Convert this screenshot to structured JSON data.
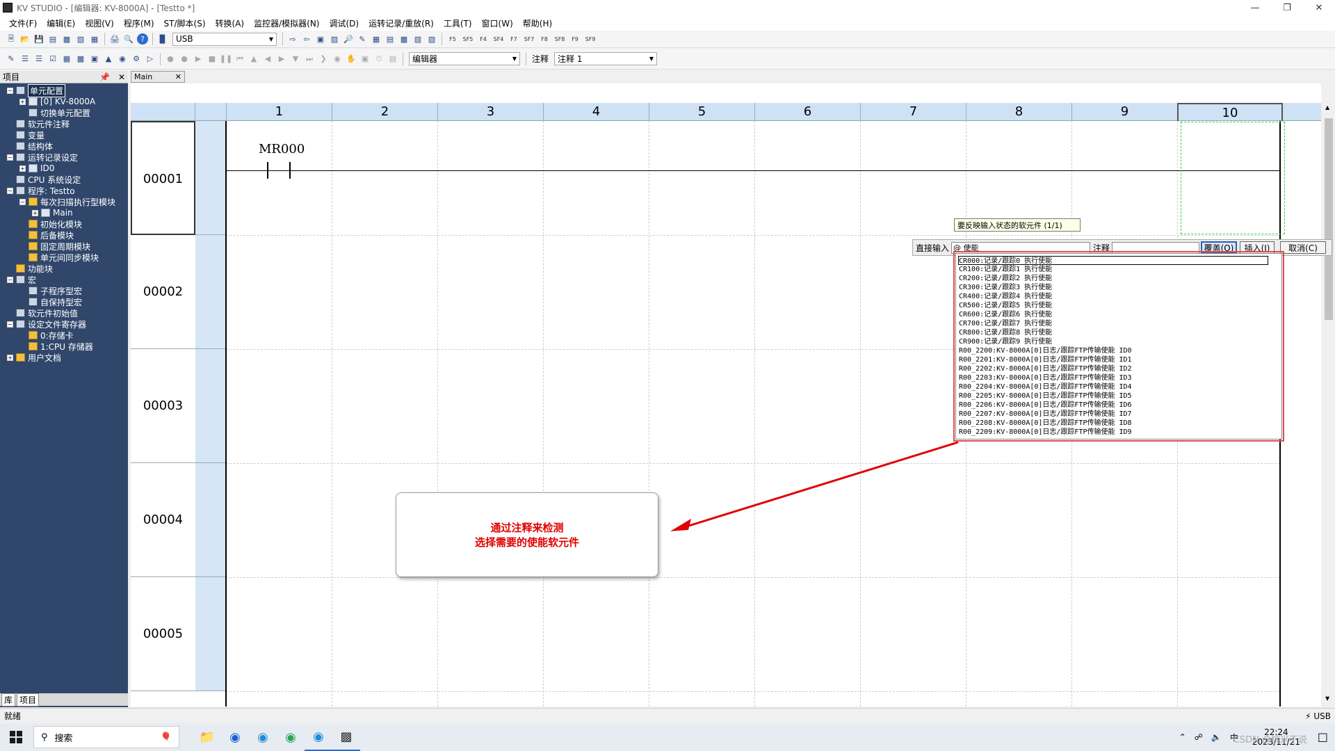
{
  "window": {
    "title": "KV STUDIO - [编辑器: KV-8000A] - [Testto *]",
    "min_icon": "minimize-icon",
    "max_icon": "restore-icon",
    "close_icon": "close-icon"
  },
  "menu": [
    "文件(F)",
    "编辑(E)",
    "视图(V)",
    "程序(M)",
    "ST/脚本(S)",
    "转换(A)",
    "监控器/模拟器(N)",
    "调试(D)",
    "运转记录/重放(R)",
    "工具(T)",
    "窗口(W)",
    "帮助(H)"
  ],
  "toolbar1": {
    "connection": "USB",
    "fkeys": [
      "F5",
      "SF5",
      "F4",
      "SF4",
      "F7",
      "SF7",
      "F8",
      "SF8",
      "F9",
      "SF9"
    ]
  },
  "toolbar2": {
    "mode": "编辑器",
    "comment_label": "注释",
    "comment_value": "注释 1"
  },
  "project_panel": {
    "title": "项目",
    "items": [
      {
        "label": "单元配置",
        "level": 0,
        "expander": "−",
        "icon": "grid",
        "selected": true
      },
      {
        "label": "[0]  KV-8000A",
        "level": 1,
        "expander": "+",
        "icon": "doc"
      },
      {
        "label": "切换单元配置",
        "level": 1,
        "expander": "",
        "icon": "grid"
      },
      {
        "label": "软元件注释",
        "level": 0,
        "expander": "",
        "icon": "grid"
      },
      {
        "label": "变量",
        "level": 0,
        "expander": "",
        "icon": "grid"
      },
      {
        "label": "结构体",
        "level": 0,
        "expander": "",
        "icon": "grid"
      },
      {
        "label": "运转记录设定",
        "level": 0,
        "expander": "−",
        "icon": "grid"
      },
      {
        "label": "ID0",
        "level": 1,
        "expander": "+",
        "icon": "doc"
      },
      {
        "label": "CPU 系统设定",
        "level": 0,
        "expander": "",
        "icon": "grid"
      },
      {
        "label": "程序: Testto",
        "level": 0,
        "expander": "−",
        "icon": "grid"
      },
      {
        "label": "每次扫描执行型模块",
        "level": 1,
        "expander": "−",
        "icon": "folder"
      },
      {
        "label": "Main",
        "level": 2,
        "expander": "+",
        "icon": "doc"
      },
      {
        "label": "初始化模块",
        "level": 1,
        "expander": "",
        "icon": "folder"
      },
      {
        "label": "后备模块",
        "level": 1,
        "expander": "",
        "icon": "folder"
      },
      {
        "label": "固定周期模块",
        "level": 1,
        "expander": "",
        "icon": "folder"
      },
      {
        "label": "单元间同步模块",
        "level": 1,
        "expander": "",
        "icon": "folder"
      },
      {
        "label": "功能块",
        "level": 0,
        "expander": "",
        "icon": "folder"
      },
      {
        "label": "宏",
        "level": 0,
        "expander": "−",
        "icon": "grid"
      },
      {
        "label": "子程序型宏",
        "level": 1,
        "expander": "",
        "icon": "grid"
      },
      {
        "label": "自保持型宏",
        "level": 1,
        "expander": "",
        "icon": "grid"
      },
      {
        "label": "软元件初始值",
        "level": 0,
        "expander": "",
        "icon": "grid"
      },
      {
        "label": "设定文件寄存器",
        "level": 0,
        "expander": "−",
        "icon": "grid"
      },
      {
        "label": "0:存储卡",
        "level": 1,
        "expander": "",
        "icon": "folder"
      },
      {
        "label": "1:CPU 存储器",
        "level": 1,
        "expander": "",
        "icon": "folder"
      },
      {
        "label": "用户文档",
        "level": 0,
        "expander": "+",
        "icon": "folder"
      }
    ],
    "tabs": [
      "库",
      "项目"
    ]
  },
  "editor": {
    "tab": "Main",
    "columns": [
      "1",
      "2",
      "3",
      "4",
      "5",
      "6",
      "7",
      "8",
      "9",
      "10"
    ],
    "rows": [
      "00001",
      "00002",
      "00003",
      "00004",
      "00005"
    ],
    "contact": "MR000"
  },
  "tooltip": "要反映输入状态的软元件  (1/1)",
  "input_bar": {
    "direct_label": "直接输入",
    "direct_value": "@ 使能",
    "comment_label": "注释",
    "overwrite": "覆盖(O)",
    "insert": "插入(I)",
    "cancel": "取消(C)"
  },
  "suggestions": [
    "CR000:记录/跟踪0 执行使能",
    "CR100:记录/跟踪1 执行使能",
    "CR200:记录/跟踪2 执行使能",
    "CR300:记录/跟踪3 执行使能",
    "CR400:记录/跟踪4 执行使能",
    "CR500:记录/跟踪5 执行使能",
    "CR600:记录/跟踪6 执行使能",
    "CR700:记录/跟踪7 执行使能",
    "CR800:记录/跟踪8 执行使能",
    "CR900:记录/跟踪9 执行使能",
    "R00_2200:KV-8000A[0]日志/跟踪FTP传输使能 ID0",
    "R00_2201:KV-8000A[0]日志/跟踪FTP传输使能 ID1",
    "R00_2202:KV-8000A[0]日志/跟踪FTP传输使能 ID2",
    "R00_2203:KV-8000A[0]日志/跟踪FTP传输使能 ID3",
    "R00_2204:KV-8000A[0]日志/跟踪FTP传输使能 ID4",
    "R00_2205:KV-8000A[0]日志/跟踪FTP传输使能 ID5",
    "R00_2206:KV-8000A[0]日志/跟踪FTP传输使能 ID6",
    "R00_2207:KV-8000A[0]日志/跟踪FTP传输使能 ID7",
    "R00_2208:KV-8000A[0]日志/跟踪FTP传输使能 ID8",
    "R00_2209:KV-8000A[0]日志/跟踪FTP传输使能 ID9"
  ],
  "annotation": {
    "line1": "通过注释来检测",
    "line2": "选择需要的使能软元件",
    "color": "#e00000"
  },
  "status": {
    "left": "就绪",
    "right": "USB"
  },
  "taskbar": {
    "search": "搜索",
    "time": "22:24",
    "date": "2023/11/21",
    "watermark": "CSDN @桃米不说"
  }
}
